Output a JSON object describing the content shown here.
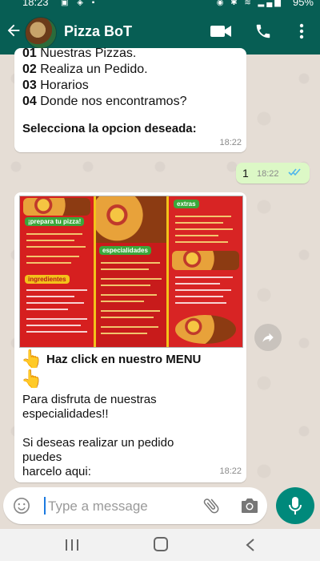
{
  "status_bar": {
    "time": "18:23",
    "battery": "95%"
  },
  "header": {
    "title": "Pizza BoT"
  },
  "messages": {
    "menu_options": [
      {
        "num": "01",
        "text": "Nuestras Pizzas."
      },
      {
        "num": "02",
        "text": "Realiza un Pedido."
      },
      {
        "num": "03",
        "text": "Horarios"
      },
      {
        "num": "04",
        "text": "Donde nos encontramos?"
      }
    ],
    "prompt": "Selecciona la opcion deseada:",
    "msg1_time": "18:22",
    "reply_text": "1",
    "reply_time": "18:22",
    "menu_image": {
      "section1": "¡prepara tu pizza!",
      "section2": "especialidades",
      "section3": "extras",
      "section4": "ingredientes"
    },
    "cta": "Haz click en nuestro MENU",
    "body_line1": "Para disfruta de nuestras",
    "body_line2": "especialidades!!",
    "body_line3": "Si deseas realizar un pedido",
    "body_line4": "puedes",
    "body_line5": "harcelo aqui:",
    "msg3_time": "18:22"
  },
  "composer": {
    "placeholder": "Type a message"
  },
  "colors": {
    "header": "#075e54",
    "outgoing": "#dcf8c6",
    "accent": "#00897b"
  },
  "icons": [
    "back-arrow-icon",
    "video-call-icon",
    "phone-icon",
    "more-vert-icon",
    "emoji-icon",
    "attach-icon",
    "camera-icon",
    "mic-icon",
    "forward-icon"
  ]
}
